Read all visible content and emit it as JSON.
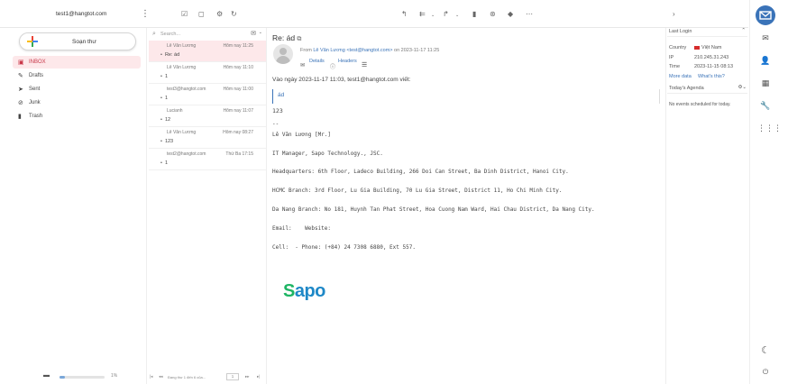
{
  "header": {
    "user_email": "test1@hangtot.com",
    "toolbar_icons": [
      "check-square-icon",
      "square-icon",
      "gear-icon",
      "refresh-icon",
      "reply-icon",
      "reply-all-icon",
      "forward-icon",
      "delete-icon",
      "archive-icon",
      "tag-icon",
      "more-icon"
    ]
  },
  "sidebar": {
    "compose_label": "Soạn thư",
    "folders": [
      {
        "label": "INBOX",
        "icon": "inbox-icon",
        "selected": true
      },
      {
        "label": "Drafts",
        "icon": "pencil-icon"
      },
      {
        "label": "Sent",
        "icon": "send-icon"
      },
      {
        "label": "Junk",
        "icon": "junk-icon"
      },
      {
        "label": "Trash",
        "icon": "trash-icon"
      }
    ],
    "quota_percent": "1%",
    "quota_fraction": 0.01
  },
  "list": {
    "search_placeholder": "Search...",
    "messages": [
      {
        "from": "Lê Văn Lương",
        "date": "Hôm nay 11:25",
        "subject": "Re: ád",
        "selected": true
      },
      {
        "from": "Lê Văn Lương",
        "date": "Hôm nay 11:10",
        "subject": "1"
      },
      {
        "from": "test3@hangtot.com",
        "date": "Hôm nay 11:00",
        "subject": "1"
      },
      {
        "from": "Lucianh",
        "date": "Hôm nay 11:07",
        "subject": "12"
      },
      {
        "from": "Lê Văn Lương",
        "date": "Hôm nay 08:27",
        "subject": "123"
      },
      {
        "from": "test2@hangtot.com",
        "date": "Thứ Ba 17:15",
        "subject": "1"
      }
    ],
    "pager": {
      "text": "Đang thư 1 đến 6 của...",
      "page": "1"
    }
  },
  "message": {
    "subject": "Re: ád",
    "from_prefix": "From",
    "from_name": "Lê Văn Lương",
    "from_email": "<test@hangtot.com>",
    "from_date": "on 2023-11-17 11:25",
    "details_label": "Details",
    "headers_label": "Headers",
    "intro": "Vào ngày 2023-11-17 11:03, test1@hangtot.com viết:",
    "quote": "ád",
    "line_123": "123",
    "sep": "--",
    "sig_name": "Lê Văn Lương [Mr.]",
    "sig_title": "IT Manager, Sapo Technology., JSC.",
    "hq": "Headquarters: 6th Floor, Ladeco Building, 266 Doi Can Street, Ba Dinh District, Hanoi City.",
    "hcmc": "HCMC Branch: 3rd Floor, Lu Gia Building, 70 Lu Gia Street, District 11, Ho Chi Minh City.",
    "danang": "Da Nang Branch: No 181, Huynh Tan Phat Street, Hoa Cuong Nam Ward, Hai Chau District, Da Nang City.",
    "email_line": "Email:    Website:",
    "cell_line": "Cell:  - Phone: (+84) 24 7308 6880, Ext 557.",
    "logo_s": "S",
    "logo_rest": "apo"
  },
  "right_panel": {
    "last_login_title": "Last Login",
    "country_label": "Country",
    "country_value": "Việt Nam",
    "ip_label": "IP",
    "ip_value": "210.245.31.243",
    "time_label": "Time",
    "time_value": "2023-11-15 08:13",
    "more_data": "More data",
    "whats_this": "What's this?",
    "agenda_title": "Today's Agenda",
    "no_events": "No events scheduled for today."
  },
  "colors": {
    "accent": "#3a73b8",
    "selected_bg": "#fde8ea",
    "brand_green": "#1eb564",
    "brand_blue": "#1e88c7"
  }
}
